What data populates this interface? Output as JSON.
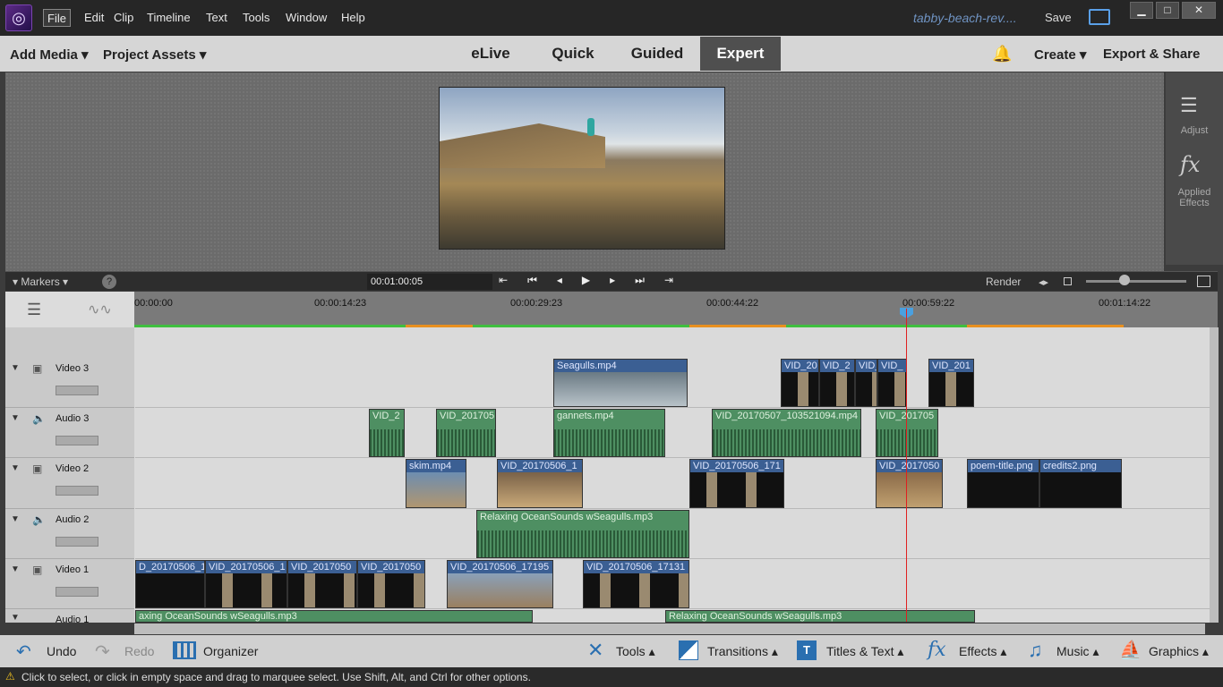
{
  "menubar": {
    "items": [
      "File",
      "Edit",
      "Clip",
      "Timeline",
      "Text",
      "Tools",
      "Window",
      "Help"
    ],
    "doc_title": "tabby-beach-rev....",
    "save_label": "Save"
  },
  "modebar": {
    "add_media": "Add Media",
    "project_assets": "Project Assets",
    "tabs": [
      "eLive",
      "Quick",
      "Guided",
      "Expert"
    ],
    "active_tab": "Expert",
    "create": "Create",
    "export_share": "Export & Share"
  },
  "right_panel": {
    "adjust": "Adjust",
    "applied_effects": "Applied Effects"
  },
  "timeline_controls": {
    "markers": "Markers",
    "current_time": "00:01:00:05",
    "render": "Render"
  },
  "ruler": {
    "ticks": [
      "00:00:00",
      "00:00:14:23",
      "00:00:29:23",
      "00:00:44:22",
      "00:00:59:22",
      "00:01:14:22"
    ]
  },
  "tracks": [
    {
      "name": "Video 3",
      "type": "video"
    },
    {
      "name": "Audio 3",
      "type": "audio"
    },
    {
      "name": "Video 2",
      "type": "video"
    },
    {
      "name": "Audio 2",
      "type": "audio"
    },
    {
      "name": "Video 1",
      "type": "video"
    },
    {
      "name": "Audio 1",
      "type": "audio"
    }
  ],
  "clips": {
    "video3": [
      "Seagulls.mp4",
      "VID_20",
      "VID_2",
      "VID_",
      "VID_",
      "VID_201"
    ],
    "audio3": [
      "VID_2",
      "VID_201705",
      "gannets.mp4",
      "VID_20170507_103521094.mp4",
      "VID_201705"
    ],
    "video2": [
      "skim.mp4",
      "VID_20170506_1",
      "VID_20170506_171",
      "VID_2017050",
      "poem-title.png",
      "credits2.png"
    ],
    "audio2": [
      "Relaxing OceanSounds wSeagulls.mp3"
    ],
    "video1": [
      "D_20170506_1",
      "VID_20170506_1",
      "VID_2017050",
      "VID_2017050",
      "VID_20170506_17195",
      "VID_20170506_17131"
    ],
    "audio1": [
      "axing OceanSounds wSeagulls.mp3",
      "Relaxing OceanSounds wSeagulls.mp3"
    ]
  },
  "bottom_bar": {
    "undo": "Undo",
    "redo": "Redo",
    "organizer": "Organizer",
    "tools": "Tools",
    "transitions": "Transitions",
    "titles_text": "Titles & Text",
    "effects": "Effects",
    "music": "Music",
    "graphics": "Graphics"
  },
  "status": "Click to select, or click in empty space and drag to marquee select. Use Shift, Alt, and Ctrl for other options.",
  "colors": {
    "video_clip": "#3b5f93",
    "audio_clip": "#4e8f62",
    "playhead": "#e02020",
    "accent": "#0a84d8"
  }
}
